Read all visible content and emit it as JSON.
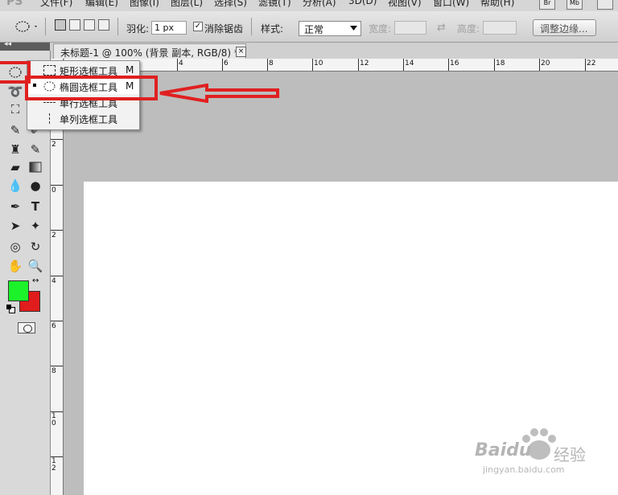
{
  "app": {
    "logo_text": "PS"
  },
  "menubar": {
    "items": [
      "文件(F)",
      "编辑(E)",
      "图像(I)",
      "图层(L)",
      "选择(S)",
      "滤镜(T)",
      "分析(A)",
      "3D(D)",
      "视图(V)",
      "窗口(W)",
      "帮助(H)"
    ],
    "badges": [
      "Br",
      "Mb"
    ]
  },
  "options_bar": {
    "feather_label": "羽化:",
    "feather_value": "1 px",
    "antialias_label": "消除锯齿",
    "antialias_checked": true,
    "style_label": "样式:",
    "style_value": "正常",
    "width_label": "宽度:",
    "height_label": "高度:",
    "refine_edge_label": "调整边缘..."
  },
  "document": {
    "tab_title": "未标题-1 @ 100% (背景 副本, RGB/8) *",
    "close_glyph": "×"
  },
  "rulers": {
    "horizontal": [
      "4",
      "6",
      "8",
      "10",
      "12",
      "14",
      "16",
      "18",
      "20",
      "22"
    ],
    "vertical": [
      "2",
      "0",
      "2",
      "4",
      "6",
      "8",
      "10",
      "12"
    ]
  },
  "toolbox": {
    "foreground_color": "#1cf22a",
    "background_color": "#e01c1c"
  },
  "flyout": {
    "items": [
      {
        "label": "矩形选框工具",
        "key": "M",
        "selected": false
      },
      {
        "label": "椭圆选框工具",
        "key": "M",
        "selected": true
      },
      {
        "label": "单行选框工具",
        "key": "",
        "selected": false
      },
      {
        "label": "单列选框工具",
        "key": "",
        "selected": false
      }
    ]
  },
  "annotation": {
    "color": "#e02020"
  },
  "watermark": {
    "brand": "Baidu",
    "cn": "经验",
    "url": "jingyan.baidu.com"
  }
}
